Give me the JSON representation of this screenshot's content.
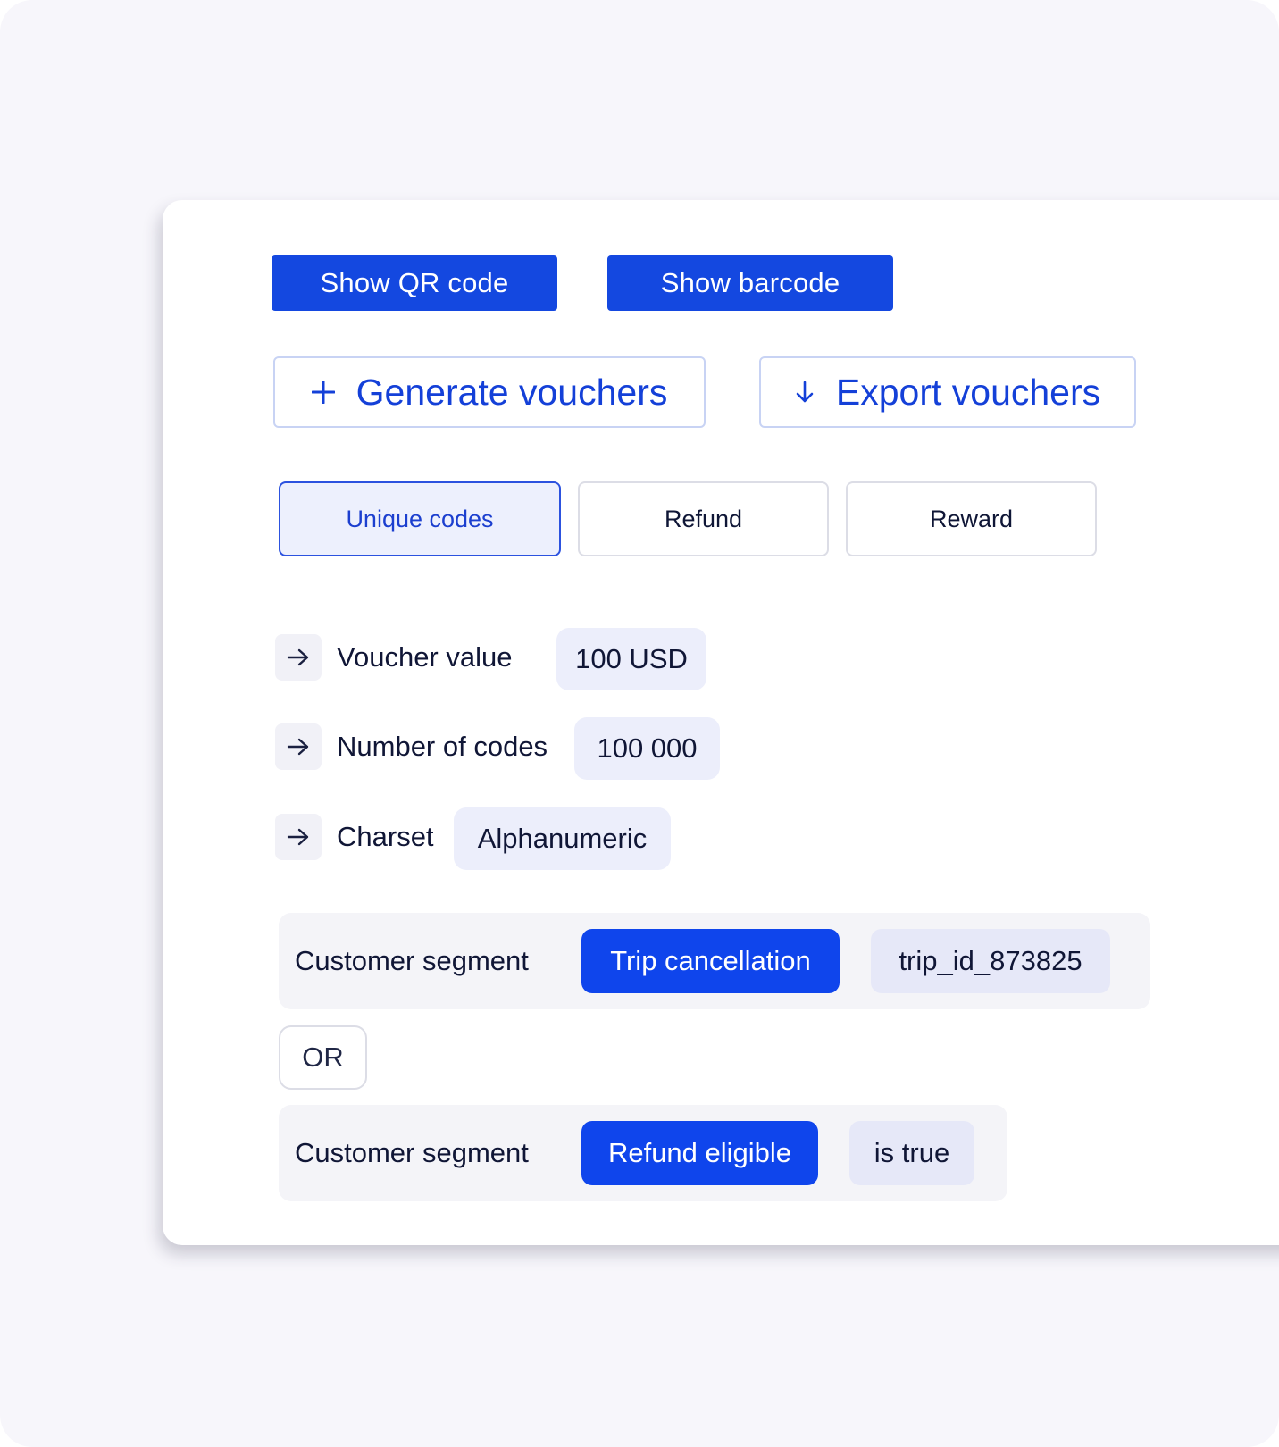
{
  "toolbar": {
    "show_qr_label": "Show QR code",
    "show_barcode_label": "Show barcode"
  },
  "actions": {
    "generate_label": "Generate vouchers",
    "generate_icon": "plus-icon",
    "export_label": "Export vouchers",
    "export_icon": "arrow-down-icon"
  },
  "tabs": [
    {
      "label": "Unique codes",
      "active": true
    },
    {
      "label": "Refund",
      "active": false
    },
    {
      "label": "Reward",
      "active": false
    }
  ],
  "params": [
    {
      "label": "Voucher value",
      "value": "100 USD",
      "icon": "arrow-right-icon"
    },
    {
      "label": "Number of codes",
      "value": "100 000",
      "icon": "arrow-right-icon"
    },
    {
      "label": "Charset",
      "value": "Alphanumeric",
      "icon": "arrow-right-icon"
    }
  ],
  "segments": [
    {
      "label": "Customer segment",
      "condition": "Trip cancellation",
      "value": "trip_id_873825"
    },
    {
      "label": "Customer segment",
      "condition": "Refund eligible",
      "value": "is true"
    }
  ],
  "operator": "OR",
  "colors": {
    "primary": "#1448e0",
    "primary_bright": "#0f45ec",
    "background": "#f7f6fb",
    "text": "#101636",
    "chip_bg": "#eceefb"
  }
}
